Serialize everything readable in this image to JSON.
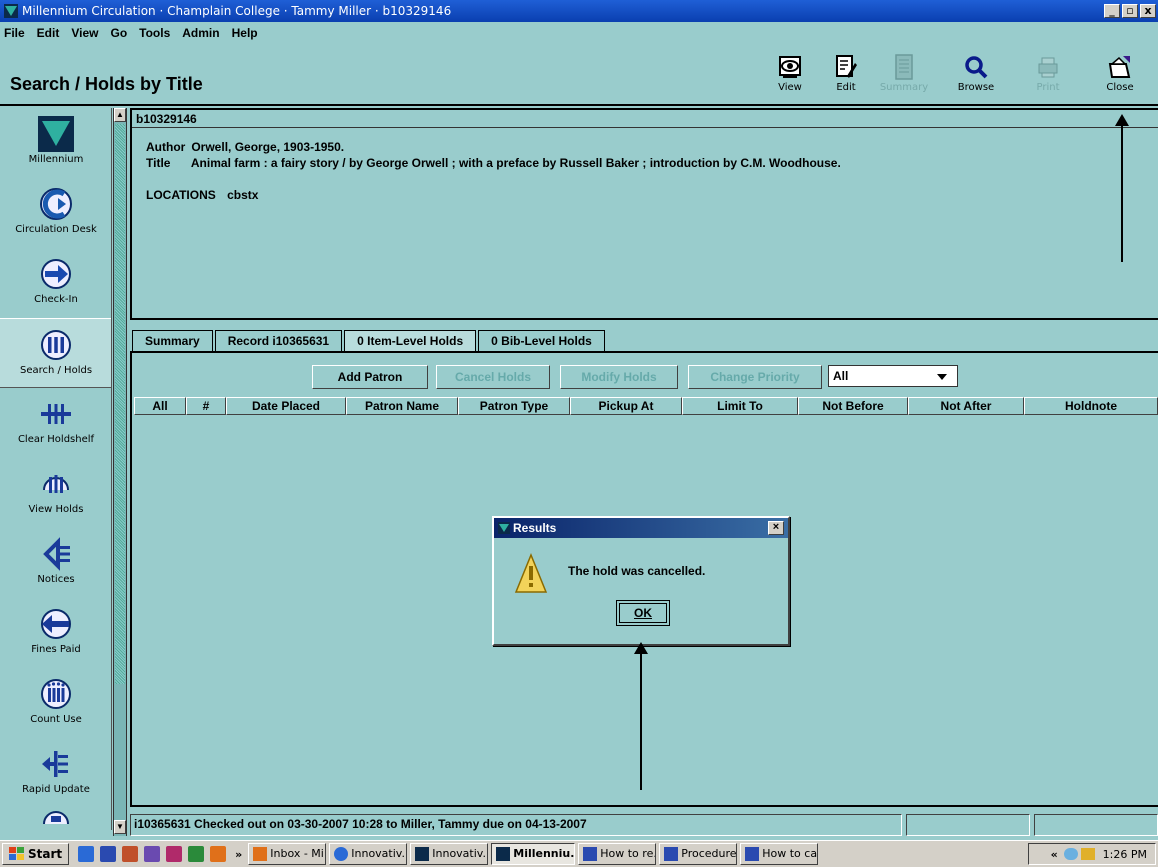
{
  "window": {
    "title": "Millennium Circulation · Champlain College · Tammy Miller · b10329146",
    "controls": [
      "_",
      "▫",
      "x"
    ]
  },
  "menu": [
    "File",
    "Edit",
    "View",
    "Go",
    "Tools",
    "Admin",
    "Help"
  ],
  "page_title": "Search / Holds by Title",
  "toolbar": [
    {
      "label": "View",
      "icon": "view-icon",
      "enabled": true
    },
    {
      "label": "Edit",
      "icon": "edit-icon",
      "enabled": true
    },
    {
      "label": "Summary",
      "icon": "summary-icon",
      "enabled": false
    },
    {
      "label": "Browse",
      "icon": "browse-icon",
      "enabled": true
    },
    {
      "label": "Print",
      "icon": "print-icon",
      "enabled": false
    },
    {
      "label": "Close",
      "icon": "close-folder-icon",
      "enabled": true
    }
  ],
  "nav": [
    {
      "label": "Millennium",
      "icon": "millennium-logo-icon"
    },
    {
      "label": "Circulation Desk",
      "icon": "circulation-desk-icon"
    },
    {
      "label": "Check-In",
      "icon": "check-in-icon"
    },
    {
      "label": "Search / Holds",
      "icon": "search-holds-icon",
      "active": true
    },
    {
      "label": "Clear Holdshelf",
      "icon": "clear-holdshelf-icon"
    },
    {
      "label": "View Holds",
      "icon": "view-holds-icon"
    },
    {
      "label": "Notices",
      "icon": "notices-icon"
    },
    {
      "label": "Fines Paid",
      "icon": "fines-paid-icon"
    },
    {
      "label": "Count Use",
      "icon": "count-use-icon"
    },
    {
      "label": "Rapid Update",
      "icon": "rapid-update-icon"
    }
  ],
  "bib": {
    "record_id": "b10329146",
    "author_label": "Author",
    "author": "Orwell, George, 1903-1950.",
    "title_label": "Title",
    "title": "Animal farm : a fairy story / by George Orwell ; with a preface by Russell Baker ; introduction by C.M. Woodhouse.",
    "locations_label": "LOCATIONS",
    "locations": "cbstx"
  },
  "tabs": [
    {
      "label": "Summary",
      "active": false
    },
    {
      "label": "Record i10365631",
      "active": false
    },
    {
      "label": "0 Item-Level Holds",
      "active": true
    },
    {
      "label": "0 Bib-Level Holds",
      "active": false
    }
  ],
  "actions": {
    "add_patron": "Add Patron",
    "cancel_holds": "Cancel Holds",
    "modify_holds": "Modify Holds",
    "change_priority": "Change Priority",
    "filter_value": "All"
  },
  "columns": [
    "All",
    "#",
    "Date Placed",
    "Patron Name",
    "Patron Type",
    "Pickup At",
    "Limit To",
    "Not Before",
    "Not After",
    "Holdnote"
  ],
  "status": "i10365631 Checked out on 03-30-2007 10:28 to Miller, Tammy due on 04-13-2007",
  "dialog": {
    "title": "Results",
    "message": "The hold was cancelled.",
    "ok": "OK",
    "icon": "warning-icon"
  },
  "taskbar": {
    "start": "Start",
    "overflow": "»",
    "tasks": [
      {
        "label": "Inbox - Mi...",
        "icon": "outlook-icon",
        "active": false
      },
      {
        "label": "Innovativ...",
        "icon": "ie-icon",
        "active": false
      },
      {
        "label": "Innovativ...",
        "icon": "millennium-icon",
        "active": false
      },
      {
        "label": "Millenniu...",
        "icon": "millennium-icon",
        "active": true
      },
      {
        "label": "How to re...",
        "icon": "word-icon",
        "active": false
      },
      {
        "label": "Procedure...",
        "icon": "word-icon",
        "active": false
      },
      {
        "label": "How to ca...",
        "icon": "word-icon",
        "active": false
      }
    ],
    "tray_chevron": "«",
    "clock": "1:26 PM"
  },
  "colors": {
    "background": "#99cccc",
    "title_bar": "#1f5fd6",
    "dialog_title": "#0a246a"
  }
}
